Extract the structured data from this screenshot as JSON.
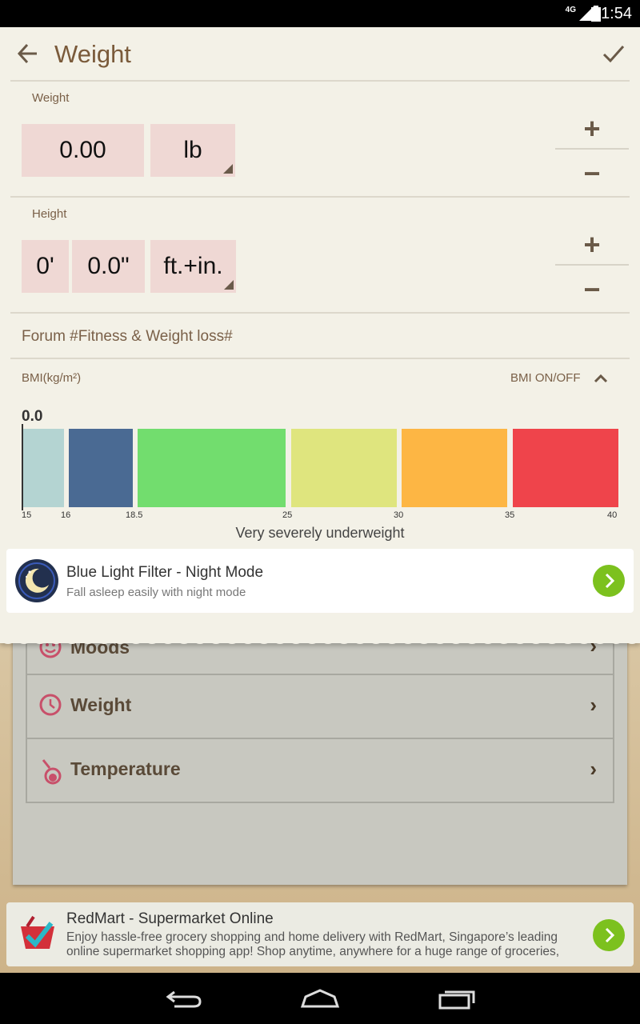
{
  "status_bar": {
    "network": "4G",
    "time": "1:54"
  },
  "header": {
    "title": "Weight",
    "back_icon": "arrow-left-icon",
    "confirm_icon": "check-icon"
  },
  "weight": {
    "label": "Weight",
    "value": "0.00",
    "unit": "lb",
    "plus": "+",
    "minus": "−"
  },
  "height": {
    "label": "Height",
    "feet": "0'",
    "inches": "0.0\"",
    "unit": "ft.+in.",
    "plus": "+",
    "minus": "−"
  },
  "forum": {
    "label": "Forum #Fitness & Weight loss#"
  },
  "bmi": {
    "label": "BMI(kg/m²)",
    "toggle": "BMI ON/OFF",
    "value": "0.0",
    "ticks": [
      "15",
      "16",
      "18.5",
      "25",
      "30",
      "35",
      "40"
    ],
    "colors": [
      "#b4d4d2",
      "#4a6a93",
      "#72dd6e",
      "#dfe57e",
      "#fdb644",
      "#ef444b"
    ],
    "status": "Very severely underweight"
  },
  "ad_top": {
    "title": "Blue Light Filter - Night Mode",
    "description": "Fall asleep easily with night mode"
  },
  "background_list": [
    {
      "label": "Moods",
      "icon": "smiley-icon"
    },
    {
      "label": "Weight",
      "icon": "clock-icon"
    },
    {
      "label": "Temperature",
      "icon": "thermometer-icon"
    }
  ],
  "ad_bottom": {
    "title": "RedMart - Supermarket Online",
    "description": "Enjoy hassle-free grocery shopping and home delivery with RedMart, Singapore’s leading online supermarket shopping app! Shop anytime, anywhere for a huge range of groceries,"
  }
}
